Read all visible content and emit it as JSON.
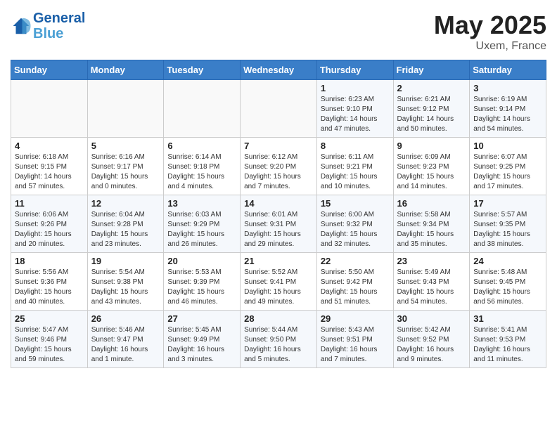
{
  "header": {
    "logo_line1": "General",
    "logo_line2": "Blue",
    "month_year": "May 2025",
    "location": "Uxem, France"
  },
  "weekdays": [
    "Sunday",
    "Monday",
    "Tuesday",
    "Wednesday",
    "Thursday",
    "Friday",
    "Saturday"
  ],
  "weeks": [
    [
      {
        "day": "",
        "info": ""
      },
      {
        "day": "",
        "info": ""
      },
      {
        "day": "",
        "info": ""
      },
      {
        "day": "",
        "info": ""
      },
      {
        "day": "1",
        "info": "Sunrise: 6:23 AM\nSunset: 9:10 PM\nDaylight: 14 hours\nand 47 minutes."
      },
      {
        "day": "2",
        "info": "Sunrise: 6:21 AM\nSunset: 9:12 PM\nDaylight: 14 hours\nand 50 minutes."
      },
      {
        "day": "3",
        "info": "Sunrise: 6:19 AM\nSunset: 9:14 PM\nDaylight: 14 hours\nand 54 minutes."
      }
    ],
    [
      {
        "day": "4",
        "info": "Sunrise: 6:18 AM\nSunset: 9:15 PM\nDaylight: 14 hours\nand 57 minutes."
      },
      {
        "day": "5",
        "info": "Sunrise: 6:16 AM\nSunset: 9:17 PM\nDaylight: 15 hours\nand 0 minutes."
      },
      {
        "day": "6",
        "info": "Sunrise: 6:14 AM\nSunset: 9:18 PM\nDaylight: 15 hours\nand 4 minutes."
      },
      {
        "day": "7",
        "info": "Sunrise: 6:12 AM\nSunset: 9:20 PM\nDaylight: 15 hours\nand 7 minutes."
      },
      {
        "day": "8",
        "info": "Sunrise: 6:11 AM\nSunset: 9:21 PM\nDaylight: 15 hours\nand 10 minutes."
      },
      {
        "day": "9",
        "info": "Sunrise: 6:09 AM\nSunset: 9:23 PM\nDaylight: 15 hours\nand 14 minutes."
      },
      {
        "day": "10",
        "info": "Sunrise: 6:07 AM\nSunset: 9:25 PM\nDaylight: 15 hours\nand 17 minutes."
      }
    ],
    [
      {
        "day": "11",
        "info": "Sunrise: 6:06 AM\nSunset: 9:26 PM\nDaylight: 15 hours\nand 20 minutes."
      },
      {
        "day": "12",
        "info": "Sunrise: 6:04 AM\nSunset: 9:28 PM\nDaylight: 15 hours\nand 23 minutes."
      },
      {
        "day": "13",
        "info": "Sunrise: 6:03 AM\nSunset: 9:29 PM\nDaylight: 15 hours\nand 26 minutes."
      },
      {
        "day": "14",
        "info": "Sunrise: 6:01 AM\nSunset: 9:31 PM\nDaylight: 15 hours\nand 29 minutes."
      },
      {
        "day": "15",
        "info": "Sunrise: 6:00 AM\nSunset: 9:32 PM\nDaylight: 15 hours\nand 32 minutes."
      },
      {
        "day": "16",
        "info": "Sunrise: 5:58 AM\nSunset: 9:34 PM\nDaylight: 15 hours\nand 35 minutes."
      },
      {
        "day": "17",
        "info": "Sunrise: 5:57 AM\nSunset: 9:35 PM\nDaylight: 15 hours\nand 38 minutes."
      }
    ],
    [
      {
        "day": "18",
        "info": "Sunrise: 5:56 AM\nSunset: 9:36 PM\nDaylight: 15 hours\nand 40 minutes."
      },
      {
        "day": "19",
        "info": "Sunrise: 5:54 AM\nSunset: 9:38 PM\nDaylight: 15 hours\nand 43 minutes."
      },
      {
        "day": "20",
        "info": "Sunrise: 5:53 AM\nSunset: 9:39 PM\nDaylight: 15 hours\nand 46 minutes."
      },
      {
        "day": "21",
        "info": "Sunrise: 5:52 AM\nSunset: 9:41 PM\nDaylight: 15 hours\nand 49 minutes."
      },
      {
        "day": "22",
        "info": "Sunrise: 5:50 AM\nSunset: 9:42 PM\nDaylight: 15 hours\nand 51 minutes."
      },
      {
        "day": "23",
        "info": "Sunrise: 5:49 AM\nSunset: 9:43 PM\nDaylight: 15 hours\nand 54 minutes."
      },
      {
        "day": "24",
        "info": "Sunrise: 5:48 AM\nSunset: 9:45 PM\nDaylight: 15 hours\nand 56 minutes."
      }
    ],
    [
      {
        "day": "25",
        "info": "Sunrise: 5:47 AM\nSunset: 9:46 PM\nDaylight: 15 hours\nand 59 minutes."
      },
      {
        "day": "26",
        "info": "Sunrise: 5:46 AM\nSunset: 9:47 PM\nDaylight: 16 hours\nand 1 minute."
      },
      {
        "day": "27",
        "info": "Sunrise: 5:45 AM\nSunset: 9:49 PM\nDaylight: 16 hours\nand 3 minutes."
      },
      {
        "day": "28",
        "info": "Sunrise: 5:44 AM\nSunset: 9:50 PM\nDaylight: 16 hours\nand 5 minutes."
      },
      {
        "day": "29",
        "info": "Sunrise: 5:43 AM\nSunset: 9:51 PM\nDaylight: 16 hours\nand 7 minutes."
      },
      {
        "day": "30",
        "info": "Sunrise: 5:42 AM\nSunset: 9:52 PM\nDaylight: 16 hours\nand 9 minutes."
      },
      {
        "day": "31",
        "info": "Sunrise: 5:41 AM\nSunset: 9:53 PM\nDaylight: 16 hours\nand 11 minutes."
      }
    ]
  ]
}
